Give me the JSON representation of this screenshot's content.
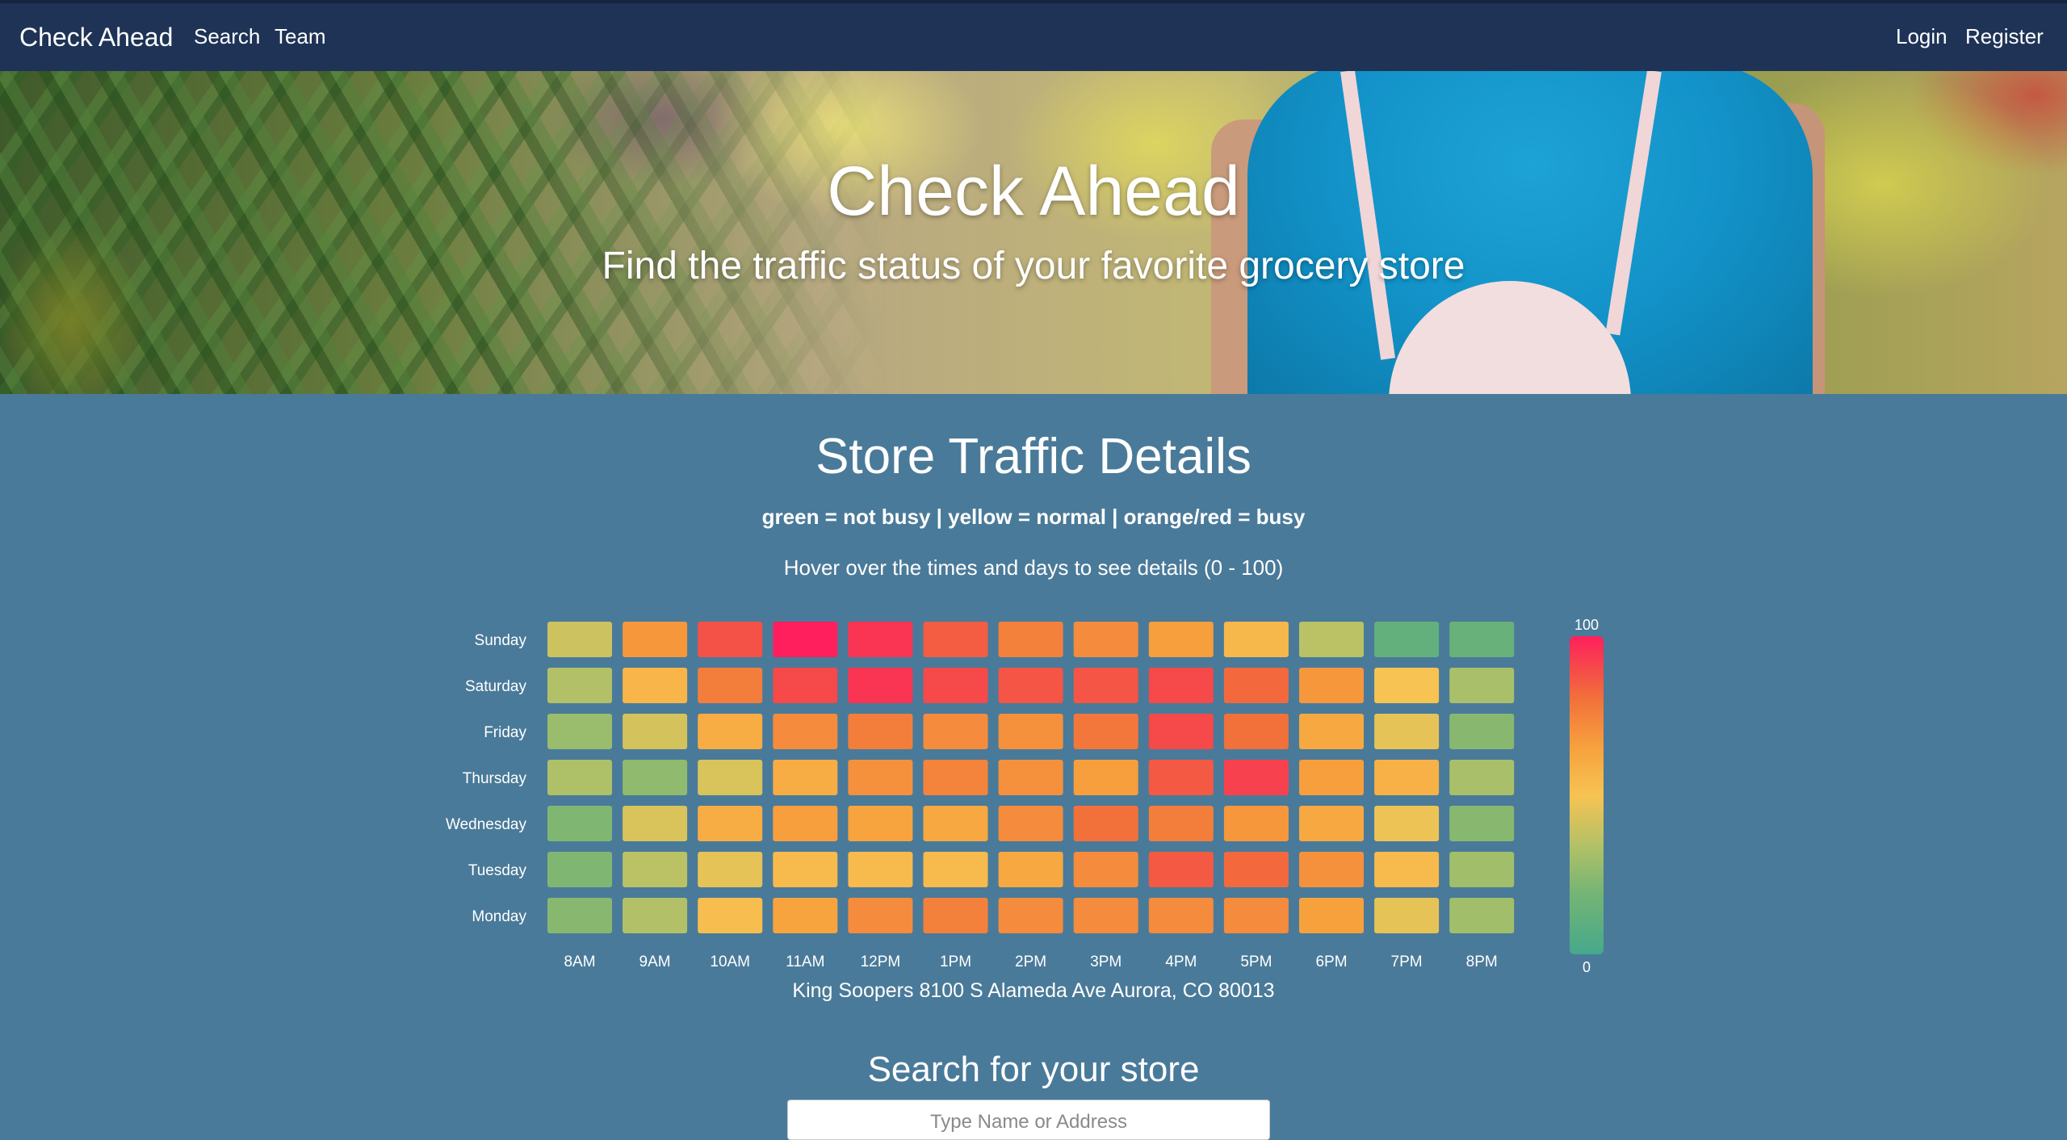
{
  "nav": {
    "brand": "Check Ahead",
    "links": [
      "Search",
      "Team"
    ],
    "auth": {
      "login": "Login",
      "register": "Register"
    }
  },
  "hero": {
    "title": "Check Ahead",
    "subtitle": "Find the traffic status of your favorite grocery store"
  },
  "traffic": {
    "title": "Store Traffic Details",
    "legend": "green = not busy | yellow = normal | orange/red = busy",
    "hover_hint": "Hover over the times and days to see details (0 - 100)",
    "address": "King Soopers 8100 S Alameda Ave Aurora, CO 80013"
  },
  "search": {
    "title": "Search for your store",
    "placeholder": "Type Name or Address"
  },
  "colors": {
    "scale_low": "#45a98b",
    "scale_mid": "#f7c352",
    "scale_high": "#ff1f5c"
  },
  "chart_data": {
    "type": "heatmap",
    "x": [
      "8AM",
      "9AM",
      "10AM",
      "11AM",
      "12PM",
      "1PM",
      "2PM",
      "3PM",
      "4PM",
      "5PM",
      "6PM",
      "7PM",
      "8PM"
    ],
    "y": [
      "Sunday",
      "Saturday",
      "Friday",
      "Thursday",
      "Wednesday",
      "Tuesday",
      "Monday"
    ],
    "values": [
      [
        40,
        68,
        88,
        100,
        95,
        85,
        75,
        72,
        66,
        55,
        36,
        12,
        14
      ],
      [
        34,
        56,
        76,
        90,
        95,
        90,
        87,
        87,
        90,
        82,
        68,
        50,
        32
      ],
      [
        28,
        42,
        60,
        72,
        76,
        72,
        70,
        78,
        90,
        80,
        62,
        46,
        24
      ],
      [
        33,
        26,
        43,
        60,
        70,
        74,
        70,
        66,
        86,
        92,
        66,
        58,
        32
      ],
      [
        22,
        43,
        60,
        66,
        64,
        62,
        72,
        80,
        76,
        68,
        62,
        48,
        24
      ],
      [
        22,
        36,
        46,
        54,
        54,
        54,
        62,
        72,
        86,
        82,
        70,
        54,
        30
      ],
      [
        24,
        34,
        52,
        64,
        72,
        75,
        72,
        72,
        72,
        72,
        65,
        46,
        30
      ]
    ],
    "colorbar": {
      "min": 0,
      "max": 100,
      "min_label": "0",
      "max_label": "100"
    }
  }
}
